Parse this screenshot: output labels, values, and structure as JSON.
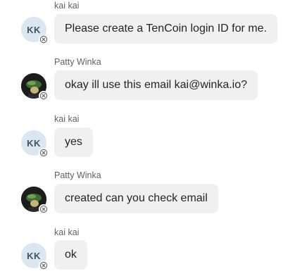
{
  "messages": [
    {
      "sender": "kai kai",
      "avatar_initials": "KK",
      "avatar_type": "initials",
      "status_icon": "offline-icon",
      "text": "Please create a TenCoin login ID for me."
    },
    {
      "sender": "Patty Winka",
      "avatar_type": "photo",
      "status_icon": "offline-icon",
      "text": "okay ill use this email kai@winka.io?"
    },
    {
      "sender": "kai kai",
      "avatar_initials": "KK",
      "avatar_type": "initials",
      "status_icon": "offline-icon",
      "text": "yes"
    },
    {
      "sender": "Patty Winka",
      "avatar_type": "photo",
      "status_icon": "offline-icon",
      "text": "created can you check email"
    },
    {
      "sender": "kai kai",
      "avatar_initials": "KK",
      "avatar_type": "initials",
      "status_icon": "offline-icon",
      "text": "ok"
    }
  ],
  "colors": {
    "bubble_background": "#f0f0f0",
    "initials_avatar_background": "#dce6ee",
    "initials_text": "#3f5366",
    "sender_text": "#616161",
    "message_text": "#242424"
  }
}
